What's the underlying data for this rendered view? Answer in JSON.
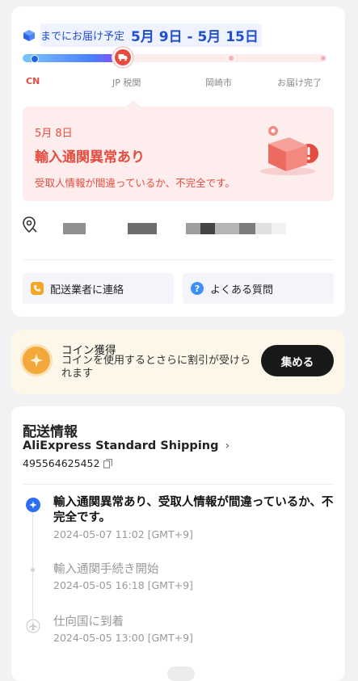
{
  "delivery": {
    "eta_prefix": "までにお届け予定",
    "eta_range": "5月 9日 - 5月 15日",
    "progress_fraction": 0.33,
    "stages": [
      "CN",
      "JP 税関",
      "岡崎市",
      "お届け完了"
    ],
    "active_stage": "CN",
    "alert": {
      "date": "5月 8日",
      "title": "輸入通関異常あり",
      "subtitle": "受取人情報が間違っているか、不完全です。"
    },
    "buttons": {
      "contact_carrier": "配送業者に連絡",
      "faq": "よくある質問"
    }
  },
  "coin": {
    "title": "コイン獲得",
    "description": "コインを使用するとさらに割引が受けられます",
    "button": "集める"
  },
  "shipping": {
    "title": "配送情報",
    "carrier": "AliExpress Standard Shipping",
    "tracking_number": "495564625452",
    "events": [
      {
        "title": "輸入通関異常あり、受取人情報が間違っているか、不完全です。",
        "time": "2024-05-07 11:02 [GMT+9]"
      },
      {
        "title": "輸入通関手続き開始",
        "time": "2024-05-05 16:18 [GMT+9]"
      },
      {
        "title": "仕向国に到着",
        "time": "2024-05-05 13:00 [GMT+9]"
      }
    ]
  },
  "colors": {
    "accent_blue": "#1f4fcf",
    "alert_red": "#e64b3f",
    "coin_orange": "#f2a83a"
  }
}
